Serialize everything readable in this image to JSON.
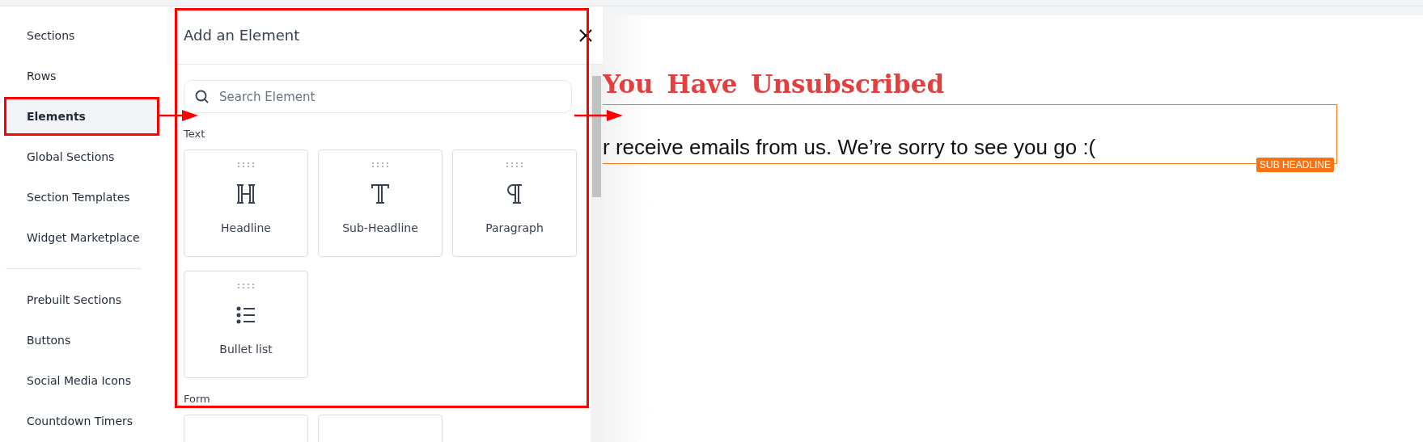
{
  "sidebar": {
    "groups": [
      {
        "items": [
          {
            "label": "Sections",
            "selected": false,
            "annotated": false
          },
          {
            "label": "Rows",
            "selected": false,
            "annotated": false
          },
          {
            "label": "Elements",
            "selected": true,
            "annotated": true
          },
          {
            "label": "Global Sections",
            "selected": false,
            "annotated": false
          },
          {
            "label": "Section Templates",
            "selected": false,
            "annotated": false
          },
          {
            "label": "Widget Marketplace",
            "selected": false,
            "annotated": false
          }
        ]
      },
      {
        "items": [
          {
            "label": "Prebuilt Sections",
            "selected": false,
            "annotated": false
          },
          {
            "label": "Buttons",
            "selected": false,
            "annotated": false
          },
          {
            "label": "Social Media Icons",
            "selected": false,
            "annotated": false
          },
          {
            "label": "Countdown Timers",
            "selected": false,
            "annotated": false
          }
        ]
      }
    ]
  },
  "panel": {
    "title": "Add an Element",
    "annotated": true,
    "search": {
      "placeholder": "Search Element"
    },
    "categories": [
      {
        "name": "Text",
        "elements": [
          {
            "label": "Headline",
            "kind": "headline"
          },
          {
            "label": "Sub-Headline",
            "kind": "subheadline"
          },
          {
            "label": "Paragraph",
            "kind": "paragraph"
          },
          {
            "label": "Bullet list",
            "kind": "bullets"
          }
        ]
      },
      {
        "name": "Form",
        "elements": [
          {
            "kind": "hidden"
          },
          {
            "kind": "hidden"
          }
        ]
      }
    ]
  },
  "canvas": {
    "headline": "You Have Unsubscribed",
    "subheadline": {
      "text": "r receive emails from us. We’re sorry to see you go :(",
      "selected": true,
      "badge": "SUB HEADLINE"
    }
  }
}
